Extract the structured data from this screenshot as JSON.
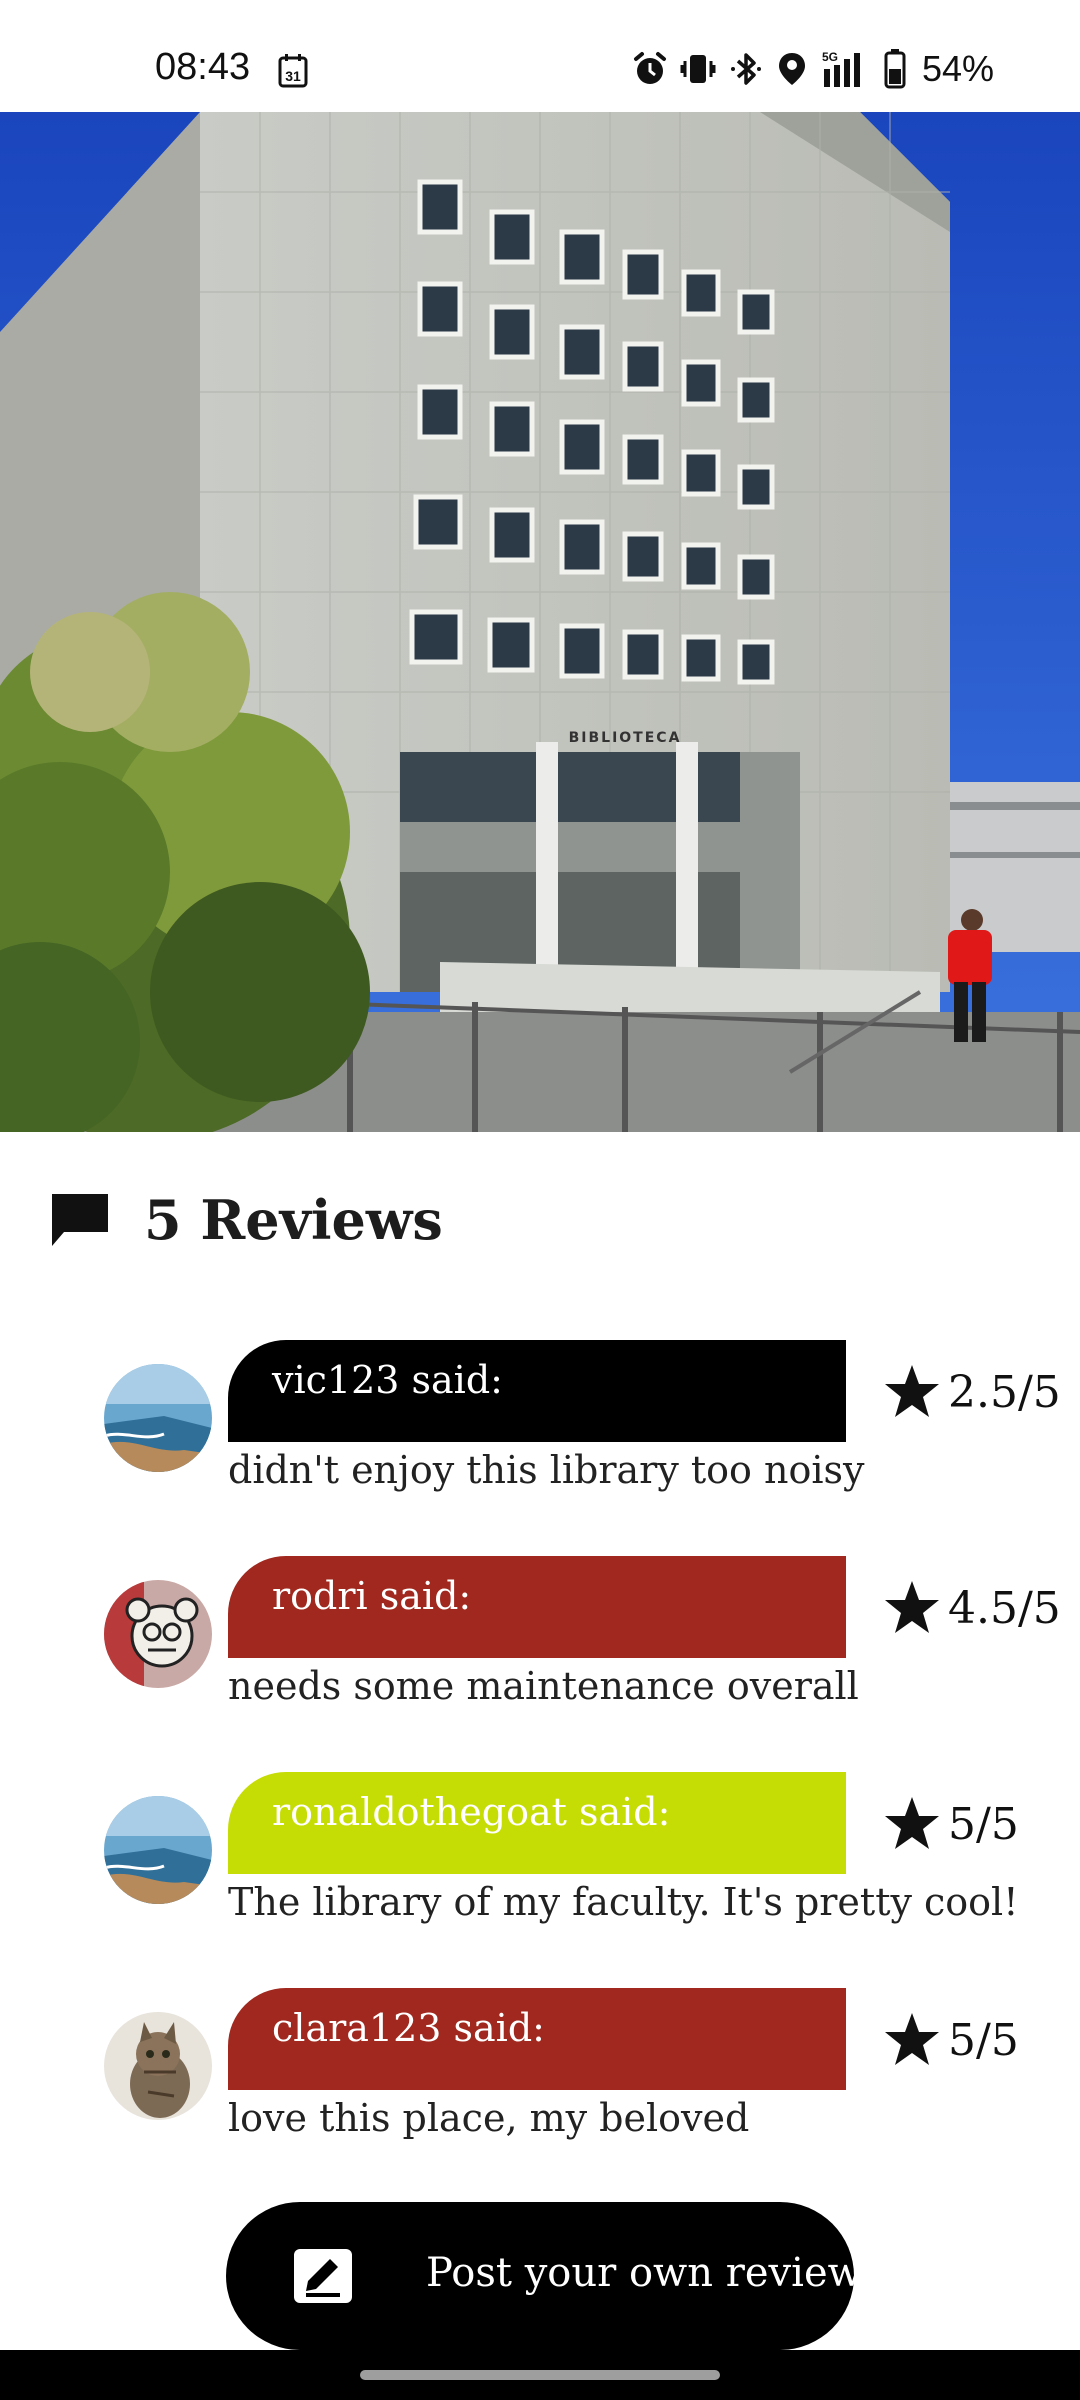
{
  "status_bar": {
    "time": "08:43",
    "calendar_day": "31",
    "battery": "54%",
    "icons": [
      "calendar-icon",
      "alarm-icon",
      "vibrate-icon",
      "bluetooth-icon",
      "location-icon",
      "signal-5g-icon",
      "battery-icon"
    ]
  },
  "hero": {
    "sign_text": "BIBLIOTECA"
  },
  "reviews_header": {
    "title": "5 Reviews",
    "icon": "comment-icon"
  },
  "reviews": [
    {
      "author_label": "vic123 said:",
      "text": "didn't enjoy this library too noisy",
      "rating": "2.5/5",
      "color": "#000000",
      "avatar": "beach-photo"
    },
    {
      "author_label": "rodri said:",
      "text": "needs some maintenance overall",
      "rating": "4.5/5",
      "color": "#a0281e",
      "avatar": "bear-sticker-photo"
    },
    {
      "author_label": "ronaldothegoat said:",
      "text": "The library of my faculty. It's pretty cool!",
      "rating": "5/5",
      "color": "#c6dc05",
      "avatar": "beach-photo"
    },
    {
      "author_label": "clara123 said:",
      "text": "love this place, my beloved",
      "rating": "5/5",
      "color": "#a0281e",
      "avatar": "cat-photo"
    }
  ],
  "post_button": {
    "label": "Post your own review",
    "icon": "edit-note-icon"
  },
  "colors": {
    "sky": "#1f4fc4",
    "accent_black": "#000000",
    "accent_red": "#a0281e",
    "accent_lime": "#c6dc05"
  }
}
